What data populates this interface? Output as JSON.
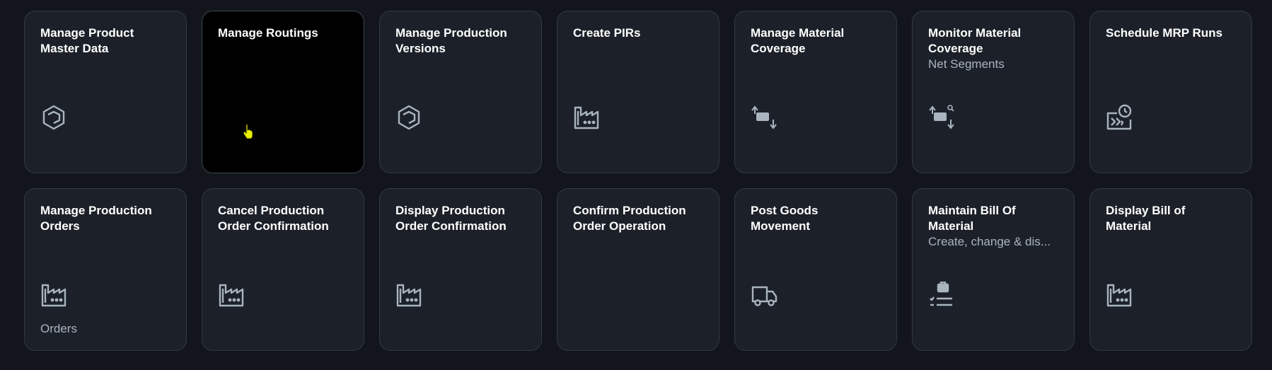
{
  "colors": {
    "background": "#12161c",
    "tile": "#1c2129",
    "tile_active": "#000000",
    "tile_border": "#323944",
    "title": "#ffffff",
    "subtitle": "#a9b4be",
    "icon": "#a9b4be"
  },
  "tiles": [
    {
      "title": "Manage Product\nMaster Data",
      "subtitle": "",
      "icon": "product-hexagon-icon",
      "footer": ""
    },
    {
      "title": "Manage Routings",
      "subtitle": "",
      "icon": "",
      "footer": "",
      "state": "hovered"
    },
    {
      "title": "Manage Production\nVersions",
      "subtitle": "",
      "icon": "product-hexagon-icon",
      "footer": ""
    },
    {
      "title": "Create PIRs",
      "subtitle": "",
      "icon": "factory-icon",
      "footer": ""
    },
    {
      "title": "Manage Material\nCoverage",
      "subtitle": "",
      "icon": "material-coverage-icon",
      "footer": ""
    },
    {
      "title": "Monitor Material\nCoverage",
      "subtitle": "Net Segments",
      "icon": "material-coverage-search-icon",
      "footer": ""
    },
    {
      "title": "Schedule MRP Runs",
      "subtitle": "",
      "icon": "mrp-schedule-icon",
      "footer": ""
    },
    {
      "title": "Manage Production\nOrders",
      "subtitle": "",
      "icon": "factory-icon",
      "footer": "Orders"
    },
    {
      "title": "Cancel Production\nOrder Confirmation",
      "subtitle": "",
      "icon": "factory-icon",
      "footer": ""
    },
    {
      "title": "Display Production\nOrder Confirmation",
      "subtitle": "",
      "icon": "factory-icon",
      "footer": ""
    },
    {
      "title": "Confirm Production\nOrder Operation",
      "subtitle": "",
      "icon": "",
      "footer": ""
    },
    {
      "title": "Post Goods\nMovement",
      "subtitle": "",
      "icon": "truck-icon",
      "footer": ""
    },
    {
      "title": "Maintain Bill Of\nMaterial",
      "subtitle": "Create, change & dis...",
      "icon": "bill-of-material-icon",
      "footer": ""
    },
    {
      "title": "Display Bill of\nMaterial",
      "subtitle": "",
      "icon": "factory-icon",
      "footer": ""
    }
  ]
}
